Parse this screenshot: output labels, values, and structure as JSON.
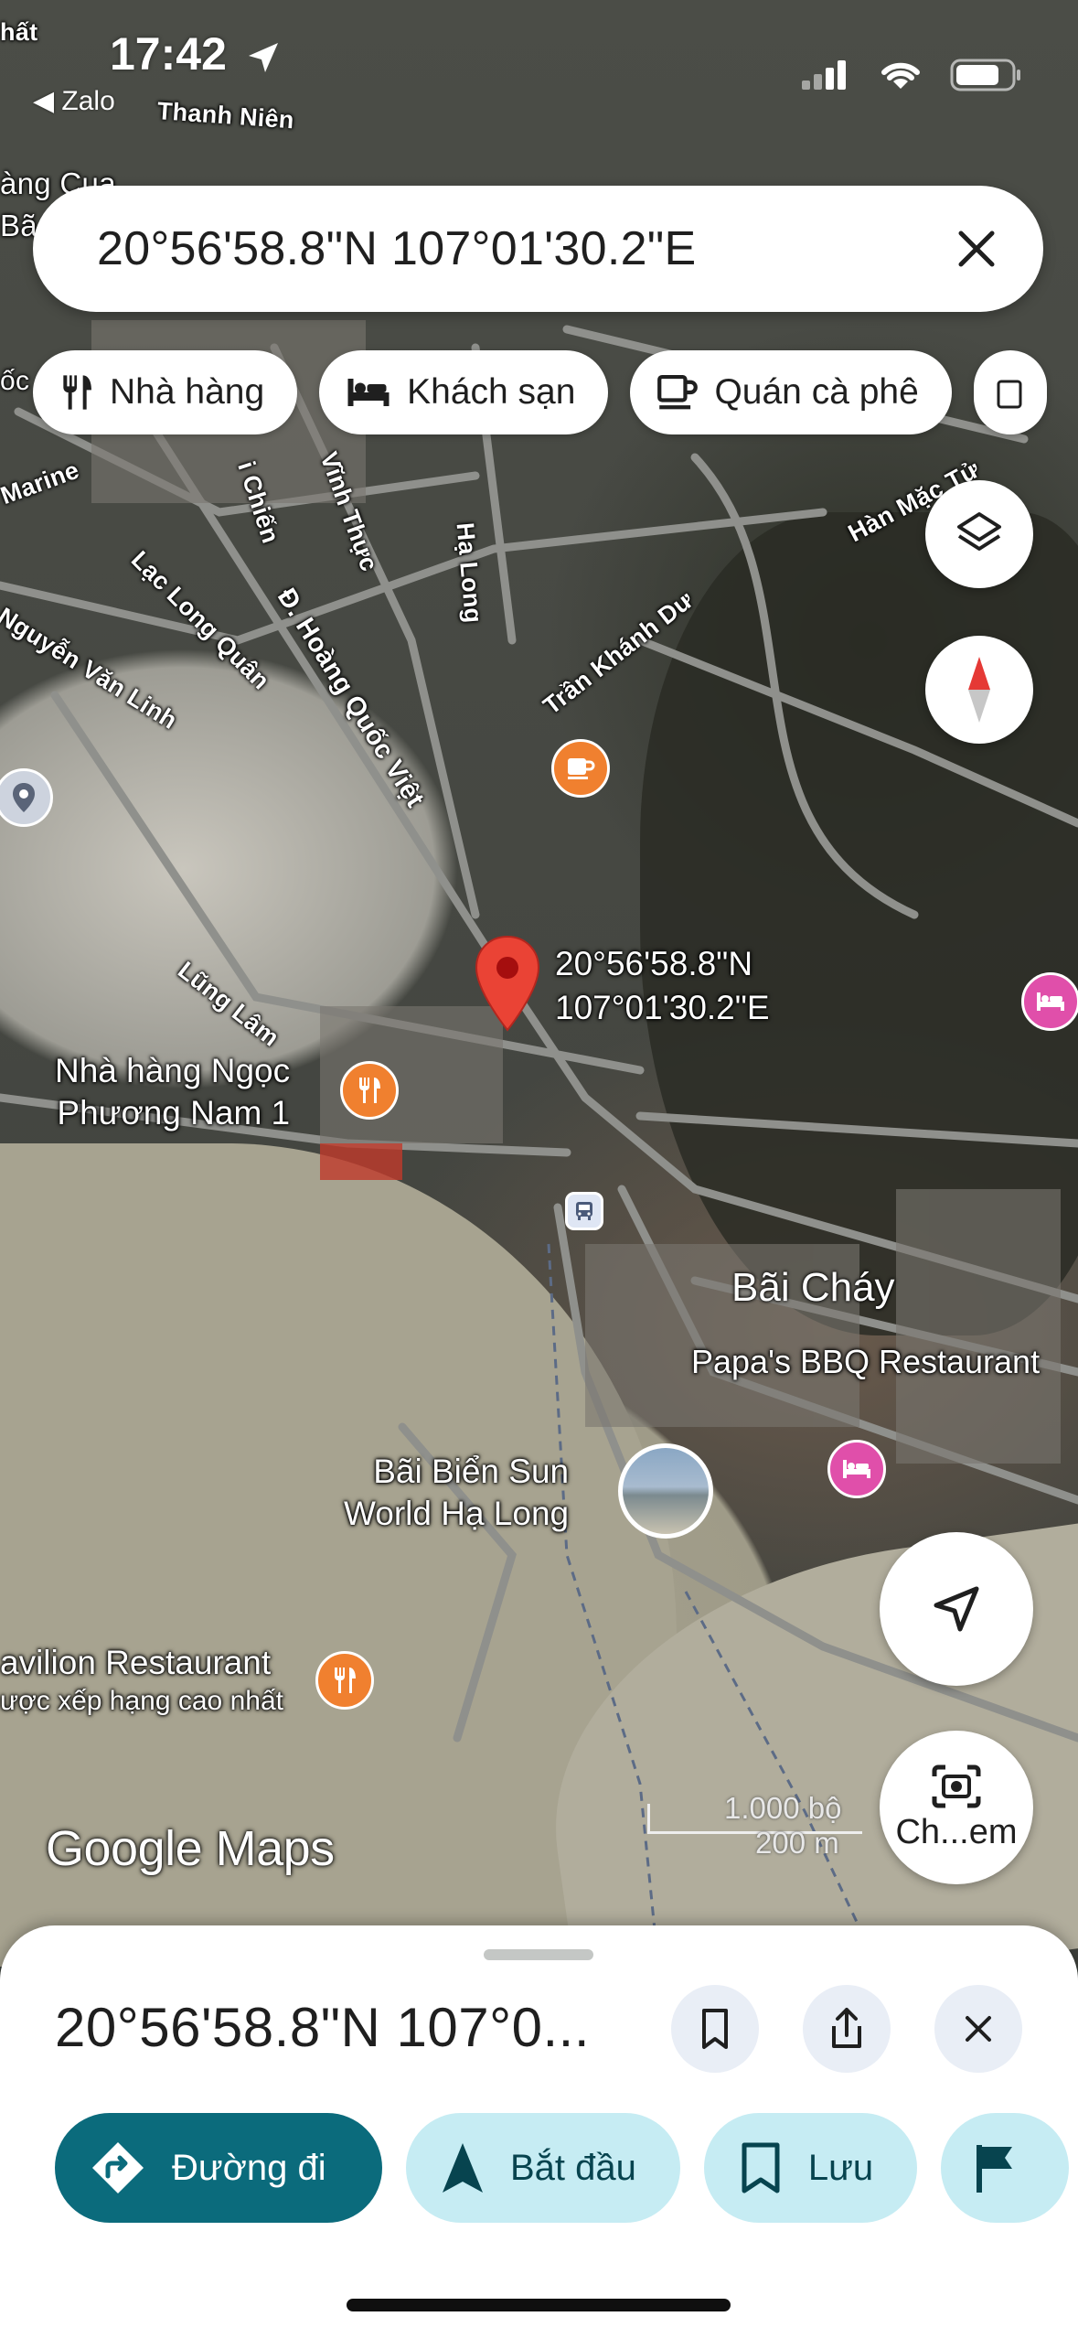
{
  "status_bar": {
    "time": "17:42",
    "back_app": "◀ Zalo"
  },
  "search": {
    "query": "20°56'58.8\"N 107°01'30.2\"E"
  },
  "chips": [
    {
      "label": "Nhà hàng",
      "icon": "fork-knife-icon"
    },
    {
      "label": "Khách sạn",
      "icon": "bed-icon"
    },
    {
      "label": "Quán cà phê",
      "icon": "coffee-cup-icon"
    }
  ],
  "map": {
    "streets": [
      "Thanh Niên",
      "Marine",
      "Lạc Long Quân",
      "Nguyễn Văn Linh",
      "Vĩnh Thực",
      "Hạ Long",
      "Trần Khánh Dư",
      "Đ. Hoàng Quốc Việt",
      "Lũng Lâm",
      "Hàn Mặc Tử",
      "i Chiến",
      "hất",
      "àng Cua",
      "Bã",
      "ốc"
    ],
    "pin_label_line1": "20°56'58.8\"N",
    "pin_label_line2": "107°01'30.2\"E",
    "area_name": "Bãi Cháy",
    "pois": {
      "restaurant1_line1": "Nhà hàng Ngọc",
      "restaurant1_line2": "Phương Nam 1",
      "papas": "Papa's BBQ Restaurant",
      "beach_line1": "Bãi Biển Sun",
      "beach_line2": "World Hạ Long",
      "pavilion_line1": "avilion Restaurant",
      "pavilion_line2": "ược xếp hạng cao nhất"
    },
    "logo": "Google Maps",
    "scale_top": "1.000 bộ",
    "scale_bottom": "200 m"
  },
  "fab": {
    "lens_label": "Ch...em"
  },
  "sheet": {
    "title": "20°56'58.8\"N 107°0...",
    "actions": {
      "directions": "Đường đi",
      "start": "Bắt đầu",
      "save": "Lưu"
    }
  },
  "colors": {
    "primary": "#0b6b7c",
    "secondary": "#c6ecf3",
    "pin": "#ea4335",
    "poi_orange": "#f0802f",
    "poi_pink": "#e04faa"
  }
}
